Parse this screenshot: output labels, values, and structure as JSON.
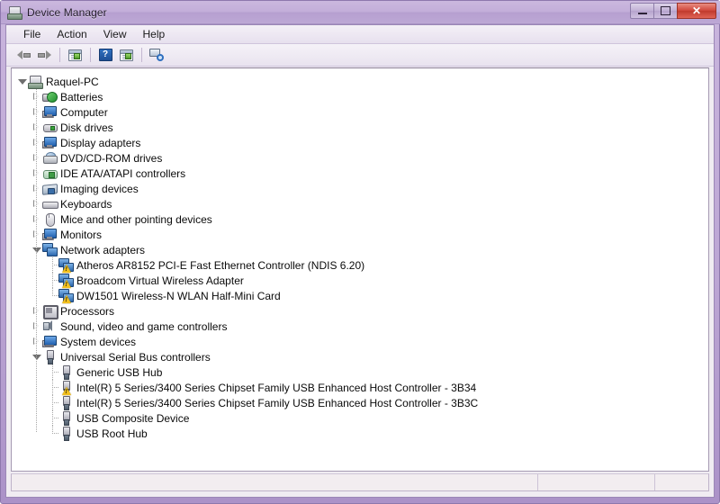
{
  "window": {
    "title": "Device Manager",
    "title_icon": "device-manager-icon",
    "buttons": {
      "minimize": "minimize-button",
      "maximize": "maximize-button",
      "close_label": "✕"
    }
  },
  "menubar": {
    "items": [
      {
        "label": "File"
      },
      {
        "label": "Action"
      },
      {
        "label": "View"
      },
      {
        "label": "Help"
      }
    ]
  },
  "toolbar": {
    "items": [
      {
        "name": "back-button",
        "icon": "back-arrow-icon"
      },
      {
        "name": "forward-button",
        "icon": "forward-arrow-icon"
      },
      {
        "name": "properties-button",
        "icon": "properties-icon"
      },
      {
        "name": "help-button",
        "icon": "help-icon",
        "glyph": "?"
      },
      {
        "name": "update-driver-button",
        "icon": "update-driver-icon"
      },
      {
        "name": "scan-hardware-changes-button",
        "icon": "scan-hardware-icon"
      }
    ]
  },
  "tree": {
    "root": {
      "label": "Raquel-PC",
      "icon": "computer-icon",
      "expanded": true
    },
    "nodes": [
      {
        "label": "Batteries",
        "icon": "battery-icon",
        "expanded": false,
        "level": 1,
        "warning": false
      },
      {
        "label": "Computer",
        "icon": "monitor-icon",
        "expanded": false,
        "level": 1,
        "warning": false
      },
      {
        "label": "Disk drives",
        "icon": "disk-icon",
        "expanded": false,
        "level": 1,
        "warning": false
      },
      {
        "label": "Display adapters",
        "icon": "display-icon",
        "expanded": false,
        "level": 1,
        "warning": false
      },
      {
        "label": "DVD/CD-ROM drives",
        "icon": "dvd-icon",
        "expanded": false,
        "level": 1,
        "warning": false
      },
      {
        "label": "IDE ATA/ATAPI controllers",
        "icon": "ide-icon",
        "expanded": false,
        "level": 1,
        "warning": false
      },
      {
        "label": "Imaging devices",
        "icon": "imaging-icon",
        "expanded": false,
        "level": 1,
        "warning": false
      },
      {
        "label": "Keyboards",
        "icon": "keyboard-icon",
        "expanded": false,
        "level": 1,
        "warning": false
      },
      {
        "label": "Mice and other pointing devices",
        "icon": "mouse-icon",
        "expanded": false,
        "level": 1,
        "warning": false
      },
      {
        "label": "Monitors",
        "icon": "monitor-icon",
        "expanded": false,
        "level": 1,
        "warning": false
      },
      {
        "label": "Network adapters",
        "icon": "network-icon",
        "expanded": true,
        "level": 1,
        "warning": false
      },
      {
        "label": "Atheros AR8152 PCI-E Fast Ethernet Controller (NDIS 6.20)",
        "icon": "network-icon",
        "level": 2,
        "warning": true,
        "leaf": true
      },
      {
        "label": "Broadcom Virtual Wireless Adapter",
        "icon": "network-icon",
        "level": 2,
        "warning": true,
        "leaf": true
      },
      {
        "label": "DW1501 Wireless-N WLAN Half-Mini Card",
        "icon": "network-icon",
        "level": 2,
        "warning": true,
        "leaf": true,
        "last": true
      },
      {
        "label": "Processors",
        "icon": "processor-icon",
        "expanded": false,
        "level": 1,
        "warning": false
      },
      {
        "label": "Sound, video and game controllers",
        "icon": "sound-icon",
        "expanded": false,
        "level": 1,
        "warning": false
      },
      {
        "label": "System devices",
        "icon": "system-icon",
        "expanded": false,
        "level": 1,
        "warning": false
      },
      {
        "label": "Universal Serial Bus controllers",
        "icon": "usb-icon",
        "expanded": true,
        "level": 1,
        "warning": false
      },
      {
        "label": "Generic USB Hub",
        "icon": "usb-icon",
        "level": 2,
        "warning": false,
        "leaf": true
      },
      {
        "label": "Intel(R) 5 Series/3400 Series Chipset Family USB Enhanced Host Controller - 3B34",
        "icon": "usb-icon",
        "level": 2,
        "warning": true,
        "leaf": true
      },
      {
        "label": "Intel(R) 5 Series/3400 Series Chipset Family USB Enhanced Host Controller - 3B3C",
        "icon": "usb-icon",
        "level": 2,
        "warning": false,
        "leaf": true
      },
      {
        "label": "USB Composite Device",
        "icon": "usb-icon",
        "level": 2,
        "warning": false,
        "leaf": true
      },
      {
        "label": "USB Root Hub",
        "icon": "usb-icon",
        "level": 2,
        "warning": false,
        "leaf": true,
        "last": true
      }
    ]
  },
  "statusbar": {
    "message": "",
    "pane2": "",
    "pane3": ""
  },
  "colors": {
    "title_gradient_top": "#cbb8de",
    "title_gradient_bottom": "#bda8d5",
    "frame": "#b69fd0",
    "close_button": "#c03a2d",
    "warning_badge": "#f2c01e",
    "content_bg": "#ffffff",
    "statusbar_bg": "#f2edf0"
  }
}
